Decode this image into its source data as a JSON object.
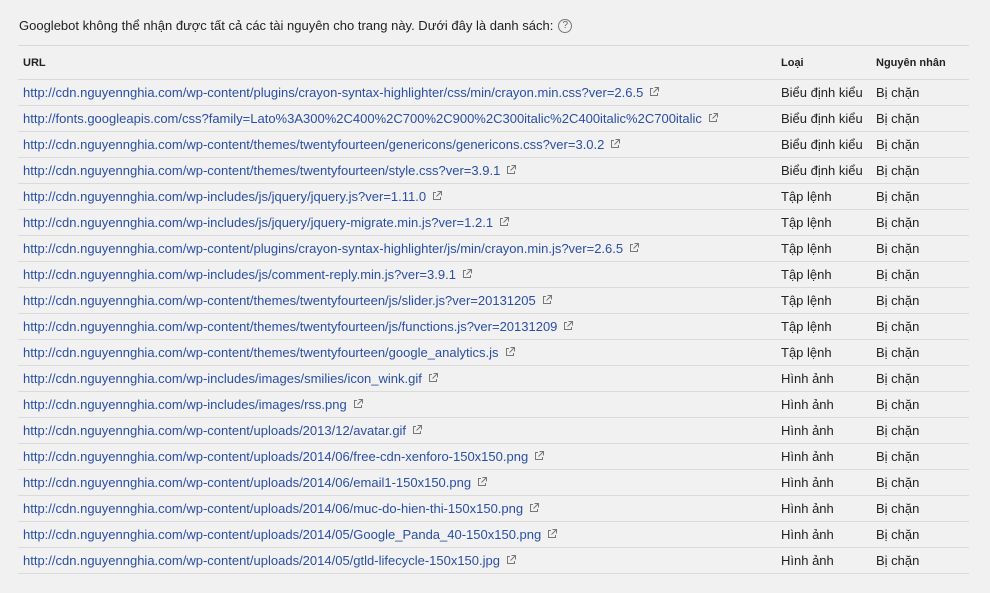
{
  "intro": {
    "text": "Googlebot không thể nhận được tất cả các tài nguyên cho trang này. Dưới đây là danh sách:",
    "help_glyph": "?"
  },
  "table": {
    "headers": {
      "url": "URL",
      "type": "Loại",
      "reason": "Nguyên nhân"
    },
    "rows": [
      {
        "url": "http://cdn.nguyennghia.com/wp-content/plugins/crayon-syntax-highlighter/css/min/crayon.min.css?ver=2.6.5",
        "type": "Biểu định kiểu",
        "reason": "Bị chặn"
      },
      {
        "url": "http://fonts.googleapis.com/css?family=Lato%3A300%2C400%2C700%2C900%2C300italic%2C400italic%2C700italic",
        "type": "Biểu định kiểu",
        "reason": "Bị chặn"
      },
      {
        "url": "http://cdn.nguyennghia.com/wp-content/themes/twentyfourteen/genericons/genericons.css?ver=3.0.2",
        "type": "Biểu định kiểu",
        "reason": "Bị chặn"
      },
      {
        "url": "http://cdn.nguyennghia.com/wp-content/themes/twentyfourteen/style.css?ver=3.9.1",
        "type": "Biểu định kiểu",
        "reason": "Bị chặn"
      },
      {
        "url": "http://cdn.nguyennghia.com/wp-includes/js/jquery/jquery.js?ver=1.11.0",
        "type": "Tập lệnh",
        "reason": "Bị chặn"
      },
      {
        "url": "http://cdn.nguyennghia.com/wp-includes/js/jquery/jquery-migrate.min.js?ver=1.2.1",
        "type": "Tập lệnh",
        "reason": "Bị chặn"
      },
      {
        "url": "http://cdn.nguyennghia.com/wp-content/plugins/crayon-syntax-highlighter/js/min/crayon.min.js?ver=2.6.5",
        "type": "Tập lệnh",
        "reason": "Bị chặn"
      },
      {
        "url": "http://cdn.nguyennghia.com/wp-includes/js/comment-reply.min.js?ver=3.9.1",
        "type": "Tập lệnh",
        "reason": "Bị chặn"
      },
      {
        "url": "http://cdn.nguyennghia.com/wp-content/themes/twentyfourteen/js/slider.js?ver=20131205",
        "type": "Tập lệnh",
        "reason": "Bị chặn"
      },
      {
        "url": "http://cdn.nguyennghia.com/wp-content/themes/twentyfourteen/js/functions.js?ver=20131209",
        "type": "Tập lệnh",
        "reason": "Bị chặn"
      },
      {
        "url": "http://cdn.nguyennghia.com/wp-content/themes/twentyfourteen/google_analytics.js",
        "type": "Tập lệnh",
        "reason": "Bị chặn"
      },
      {
        "url": "http://cdn.nguyennghia.com/wp-includes/images/smilies/icon_wink.gif",
        "type": "Hình ảnh",
        "reason": "Bị chặn"
      },
      {
        "url": "http://cdn.nguyennghia.com/wp-includes/images/rss.png",
        "type": "Hình ảnh",
        "reason": "Bị chặn"
      },
      {
        "url": "http://cdn.nguyennghia.com/wp-content/uploads/2013/12/avatar.gif",
        "type": "Hình ảnh",
        "reason": "Bị chặn"
      },
      {
        "url": "http://cdn.nguyennghia.com/wp-content/uploads/2014/06/free-cdn-xenforo-150x150.png",
        "type": "Hình ảnh",
        "reason": "Bị chặn"
      },
      {
        "url": "http://cdn.nguyennghia.com/wp-content/uploads/2014/06/email1-150x150.png",
        "type": "Hình ảnh",
        "reason": "Bị chặn"
      },
      {
        "url": "http://cdn.nguyennghia.com/wp-content/uploads/2014/06/muc-do-hien-thi-150x150.png",
        "type": "Hình ảnh",
        "reason": "Bị chặn"
      },
      {
        "url": "http://cdn.nguyennghia.com/wp-content/uploads/2014/05/Google_Panda_40-150x150.png",
        "type": "Hình ảnh",
        "reason": "Bị chặn"
      },
      {
        "url": "http://cdn.nguyennghia.com/wp-content/uploads/2014/05/gtld-lifecycle-150x150.jpg",
        "type": "Hình ảnh",
        "reason": "Bị chặn"
      }
    ]
  },
  "icons": {
    "external": "external-link-icon",
    "help": "help-circle-icon"
  },
  "colors": {
    "link": "#2a4fa4",
    "background": "#f1f1f1",
    "text": "#222222",
    "border": "#dadada"
  }
}
